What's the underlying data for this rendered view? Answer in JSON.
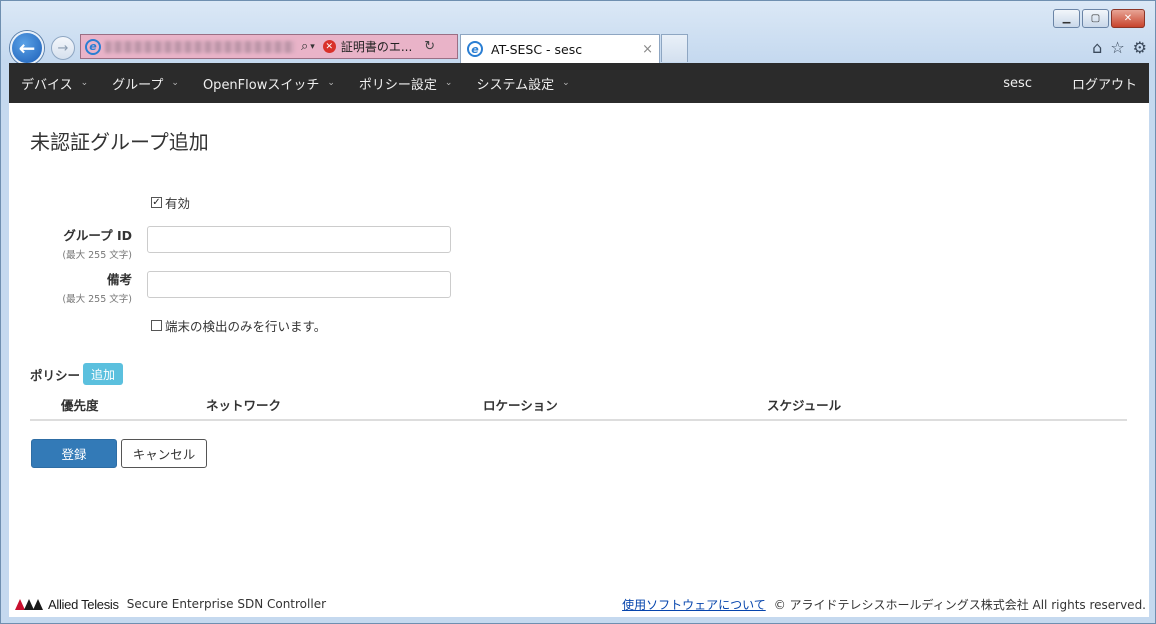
{
  "browser": {
    "tab_title": "AT-SESC - sesc",
    "cert_error": "証明書のエ...",
    "tab_close": "×"
  },
  "navbar": {
    "items": [
      {
        "label": "デバイス"
      },
      {
        "label": "グループ"
      },
      {
        "label": "OpenFlowスイッチ"
      },
      {
        "label": "ポリシー設定"
      },
      {
        "label": "システム設定"
      }
    ],
    "user": "sesc",
    "logout": "ログアウト"
  },
  "page": {
    "title": "未認証グループ追加"
  },
  "form": {
    "enabled_label": "有効",
    "enabled_checked": true,
    "group_id_label": "グループ ID",
    "group_id_hint": "(最大 255 文字)",
    "group_id_value": "",
    "note_label": "備考",
    "note_hint": "(最大 255 文字)",
    "note_value": "",
    "detect_only_label": "端末の検出のみを行います。",
    "detect_only_checked": false
  },
  "policy": {
    "label": "ポリシー",
    "add_button": "追加",
    "columns": [
      "優先度",
      "ネットワーク",
      "ロケーション",
      "スケジュール"
    ]
  },
  "actions": {
    "submit": "登録",
    "cancel": "キャンセル"
  },
  "footer": {
    "brand": "Allied Telesis",
    "product": "Secure Enterprise SDN Controller",
    "software_link": "使用ソフトウェアについて",
    "copyright": "© アライドテレシスホールディングス株式会社 All rights reserved."
  }
}
